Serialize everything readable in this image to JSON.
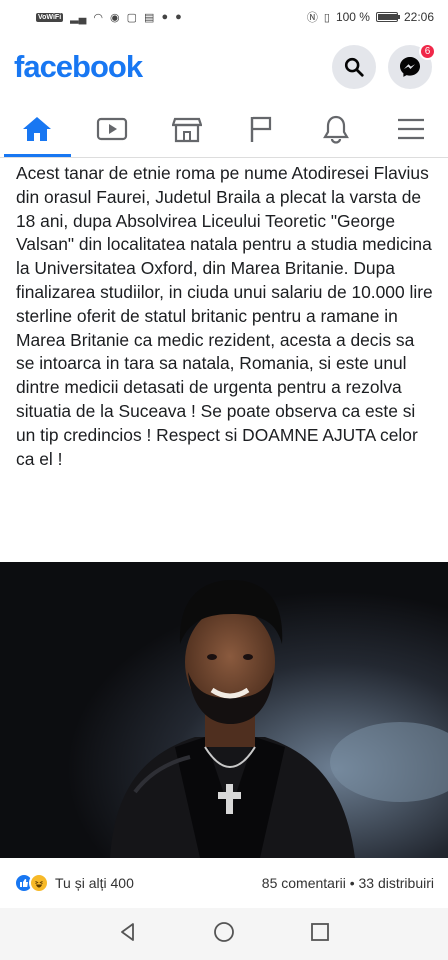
{
  "status_bar": {
    "carrier_badge": "VoWiFi",
    "battery_text": "100 %",
    "battery_level": 1.0,
    "time": "22:06"
  },
  "header": {
    "logo": "facebook",
    "messenger_badge": "6",
    "search_icon": "search-icon",
    "messenger_icon": "messenger-icon"
  },
  "nav": {
    "tabs": [
      {
        "icon": "home-icon",
        "active": true
      },
      {
        "icon": "watch-icon",
        "active": false
      },
      {
        "icon": "marketplace-icon",
        "active": false
      },
      {
        "icon": "pages-flag-icon",
        "active": false
      },
      {
        "icon": "notifications-bell-icon",
        "active": false
      },
      {
        "icon": "menu-icon",
        "active": false
      }
    ]
  },
  "post": {
    "text": "Acest tanar de etnie roma pe nume Atodiresei Flavius din orasul Faurei, Judetul Braila a plecat la varsta de 18 ani, dupa Absolvirea Liceului Teoretic \"George Valsan\" din localitatea natala pentru a studia medicina la Universitatea Oxford, din Marea Britanie. Dupa finalizarea studiilor, in ciuda unui salariu de 10.000 lire sterline oferit de statul britanic pentru a ramane in Marea Britanie ca medic rezident, acesta a decis sa se intoarca in tara sa natala, Romania, si este unul dintre medicii detasati de urgenta pentru a rezolva situatia de la Suceava ! Se poate observa ca este si un tip credincios ! Respect si DOAMNE AJUTA celor ca el !",
    "reactions_label": "Tu și alți 400",
    "comments": "85 comentarii",
    "separator": "•",
    "shares": "33 distribuiri"
  },
  "colors": {
    "brand": "#1877f2",
    "badge": "#f02849"
  }
}
